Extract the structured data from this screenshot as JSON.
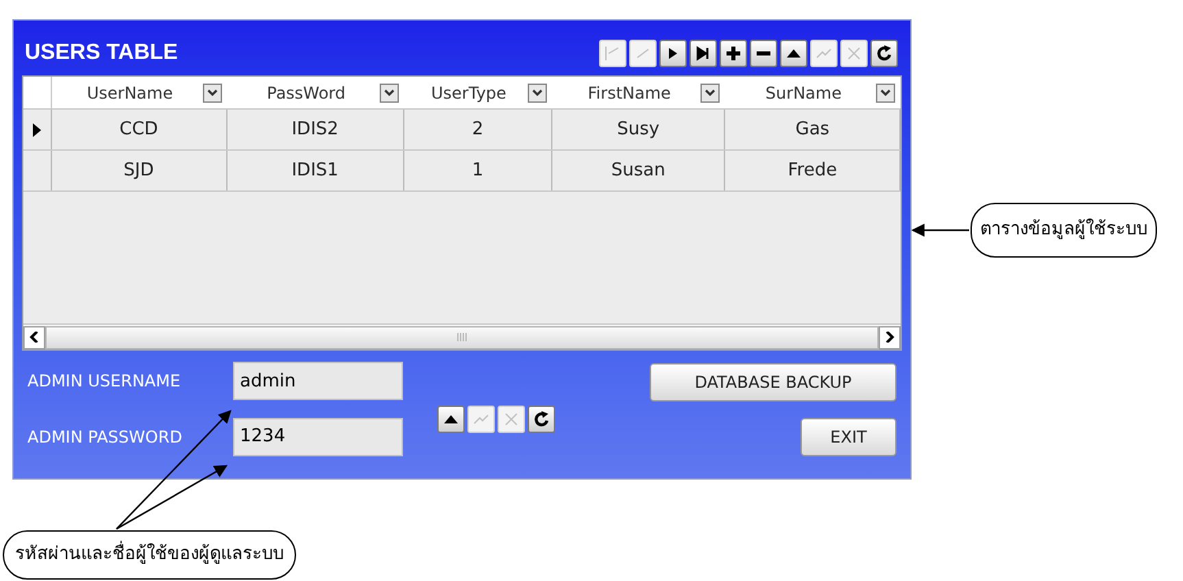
{
  "window": {
    "title": "USERS TABLE"
  },
  "navigator": [
    {
      "kind": "first",
      "disabled": true
    },
    {
      "kind": "prior",
      "disabled": true
    },
    {
      "kind": "next",
      "disabled": false
    },
    {
      "kind": "last",
      "disabled": false
    },
    {
      "kind": "insert",
      "disabled": false
    },
    {
      "kind": "delete",
      "disabled": false
    },
    {
      "kind": "edit",
      "disabled": false
    },
    {
      "kind": "post",
      "disabled": true
    },
    {
      "kind": "cancel",
      "disabled": true
    },
    {
      "kind": "refresh",
      "disabled": false
    }
  ],
  "table": {
    "columns": [
      "UserName",
      "PassWord",
      "UserType",
      "FirstName",
      "SurName"
    ],
    "rows": [
      {
        "selected": true,
        "cells": [
          "CCD",
          "IDIS2",
          "2",
          "Susy",
          "Gas"
        ]
      },
      {
        "selected": false,
        "cells": [
          "SJD",
          "IDIS1",
          "1",
          "Susan",
          "Frede"
        ]
      }
    ]
  },
  "admin": {
    "username_label": "ADMIN USERNAME",
    "username": "admin",
    "password_label": "ADMIN PASSWORD",
    "password": "1234"
  },
  "small_navigator": [
    {
      "kind": "edit",
      "disabled": false
    },
    {
      "kind": "post",
      "disabled": true
    },
    {
      "kind": "cancel",
      "disabled": true
    },
    {
      "kind": "refresh",
      "disabled": false
    }
  ],
  "buttons": {
    "backup": "DATABASE BACKUP",
    "exit": "EXIT"
  },
  "callouts": [
    {
      "text": "ตารางข้อมูลผู้ใช้ระบบ"
    },
    {
      "text": "รหัสผ่านและชื่อผู้ใช้ของผู้ดูแลระบบ"
    }
  ]
}
